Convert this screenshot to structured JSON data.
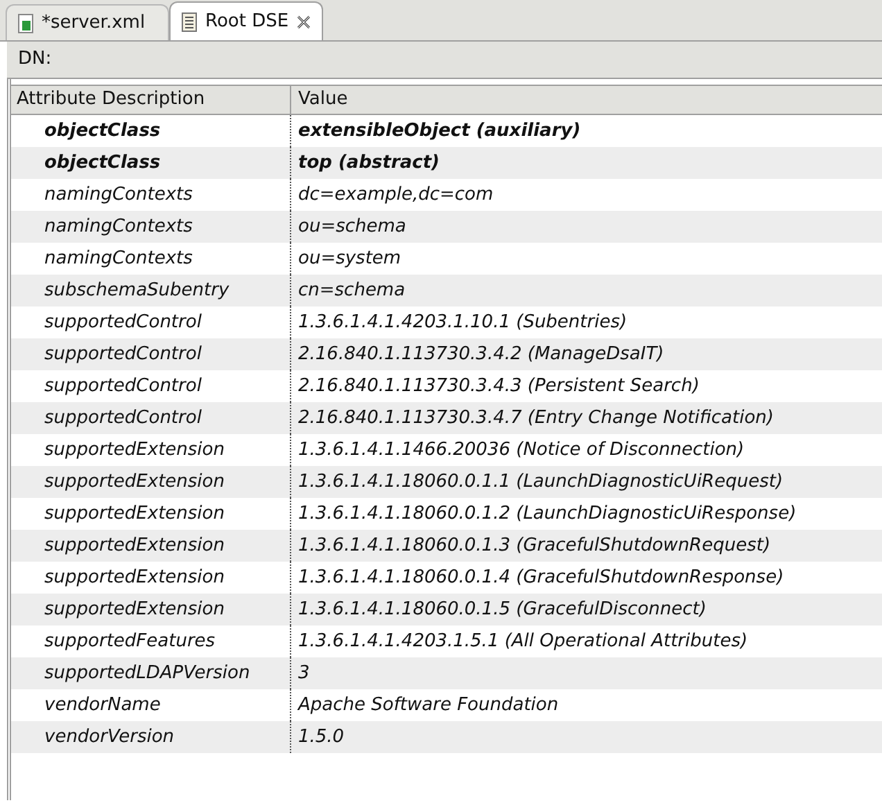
{
  "tabs": [
    {
      "label": "*server.xml",
      "selected": false,
      "closable": false,
      "kind": "xml"
    },
    {
      "label": "Root DSE",
      "selected": true,
      "closable": true,
      "kind": "entry"
    }
  ],
  "dn_label": "DN:",
  "table": {
    "columns": [
      "Attribute Description",
      "Value"
    ],
    "rows": [
      {
        "attribute": "objectClass",
        "value": "extensibleObject (auxiliary)",
        "bold": true
      },
      {
        "attribute": "objectClass",
        "value": "top (abstract)",
        "bold": true
      },
      {
        "attribute": "namingContexts",
        "value": "dc=example,dc=com",
        "bold": false
      },
      {
        "attribute": "namingContexts",
        "value": "ou=schema",
        "bold": false
      },
      {
        "attribute": "namingContexts",
        "value": "ou=system",
        "bold": false
      },
      {
        "attribute": "subschemaSubentry",
        "value": "cn=schema",
        "bold": false
      },
      {
        "attribute": "supportedControl",
        "value": "1.3.6.1.4.1.4203.1.10.1 (Subentries)",
        "bold": false
      },
      {
        "attribute": "supportedControl",
        "value": "2.16.840.1.113730.3.4.2 (ManageDsaIT)",
        "bold": false
      },
      {
        "attribute": "supportedControl",
        "value": "2.16.840.1.113730.3.4.3 (Persistent Search)",
        "bold": false
      },
      {
        "attribute": "supportedControl",
        "value": "2.16.840.1.113730.3.4.7 (Entry Change Notification)",
        "bold": false
      },
      {
        "attribute": "supportedExtension",
        "value": "1.3.6.1.4.1.1466.20036 (Notice of Disconnection)",
        "bold": false
      },
      {
        "attribute": "supportedExtension",
        "value": "1.3.6.1.4.1.18060.0.1.1 (LaunchDiagnosticUiRequest)",
        "bold": false
      },
      {
        "attribute": "supportedExtension",
        "value": "1.3.6.1.4.1.18060.0.1.2 (LaunchDiagnosticUiResponse)",
        "bold": false
      },
      {
        "attribute": "supportedExtension",
        "value": "1.3.6.1.4.1.18060.0.1.3 (GracefulShutdownRequest)",
        "bold": false
      },
      {
        "attribute": "supportedExtension",
        "value": "1.3.6.1.4.1.18060.0.1.4 (GracefulShutdownResponse)",
        "bold": false
      },
      {
        "attribute": "supportedExtension",
        "value": "1.3.6.1.4.1.18060.0.1.5 (GracefulDisconnect)",
        "bold": false
      },
      {
        "attribute": "supportedFeatures",
        "value": "1.3.6.1.4.1.4203.1.5.1 (All Operational Attributes)",
        "bold": false
      },
      {
        "attribute": "supportedLDAPVersion",
        "value": "3",
        "bold": false
      },
      {
        "attribute": "vendorName",
        "value": "Apache Software Foundation",
        "bold": false
      },
      {
        "attribute": "vendorVersion",
        "value": "1.5.0",
        "bold": false
      }
    ]
  }
}
